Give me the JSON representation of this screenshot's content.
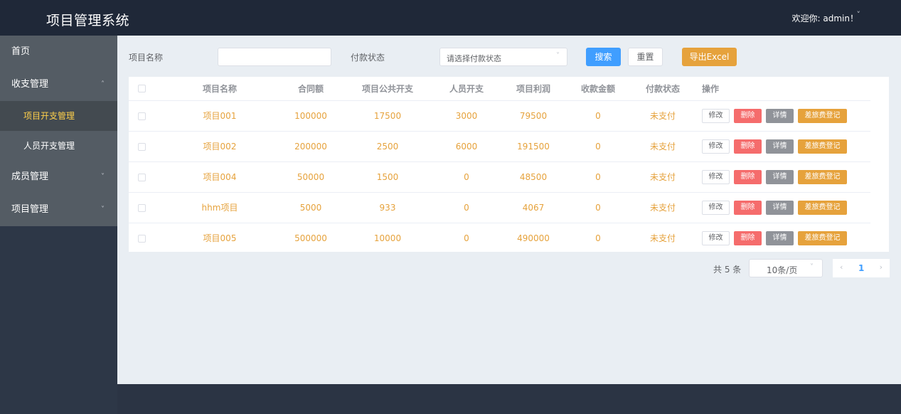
{
  "header": {
    "title": "项目管理系统",
    "welcome": "欢迎你: admin！",
    "chevron": "˅"
  },
  "sidebar": {
    "items": [
      {
        "label": "首页",
        "arrow": ""
      },
      {
        "label": "收支管理",
        "arrow": "˄"
      },
      {
        "label": "成员管理",
        "arrow": "˅"
      },
      {
        "label": "项目管理",
        "arrow": "˅"
      }
    ],
    "subitems": [
      {
        "label": "项目开支管理",
        "active": true
      },
      {
        "label": "人员开支管理",
        "active": false
      }
    ],
    "active_color": "#ffd04b"
  },
  "filters": {
    "name_label": "项目名称",
    "name_value": "",
    "status_label": "付款状态",
    "status_placeholder": "请选择付款状态",
    "search_button": "搜索",
    "reset_button": "重置",
    "export_button": "导出Excel"
  },
  "table": {
    "headers": [
      "项目名称",
      "合同额",
      "项目公共开支",
      "人员开支",
      "项目利润",
      "收款金额",
      "付款状态",
      "操作"
    ],
    "rows": [
      {
        "name": "项目001",
        "contract": "100000",
        "public": "17500",
        "staff": "3000",
        "profit": "79500",
        "received": "0",
        "status": "未支付"
      },
      {
        "name": "项目002",
        "contract": "200000",
        "public": "2500",
        "staff": "6000",
        "profit": "191500",
        "received": "0",
        "status": "未支付"
      },
      {
        "name": "项目004",
        "contract": "50000",
        "public": "1500",
        "staff": "0",
        "profit": "48500",
        "received": "0",
        "status": "未支付"
      },
      {
        "name": "hhm项目",
        "contract": "5000",
        "public": "933",
        "staff": "0",
        "profit": "4067",
        "received": "0",
        "status": "未支付"
      },
      {
        "name": "项目005",
        "contract": "500000",
        "public": "10000",
        "staff": "0",
        "profit": "490000",
        "received": "0",
        "status": "未支付"
      }
    ],
    "row_actions": {
      "edit": "修改",
      "delete": "删除",
      "detail": "详情",
      "travel": "差旅费登记"
    },
    "cell_color": "#e6a23c"
  },
  "pagination": {
    "total": "共 5 条",
    "page_size": "10条/页",
    "prev": "‹",
    "current_page": "1",
    "next": "›"
  },
  "colors": {
    "header_bg": "#1f2838",
    "sidebar_bg": "#545c64",
    "primary": "#409eff",
    "warning": "#e6a23c",
    "danger": "#f56c6c",
    "info": "#909399"
  }
}
